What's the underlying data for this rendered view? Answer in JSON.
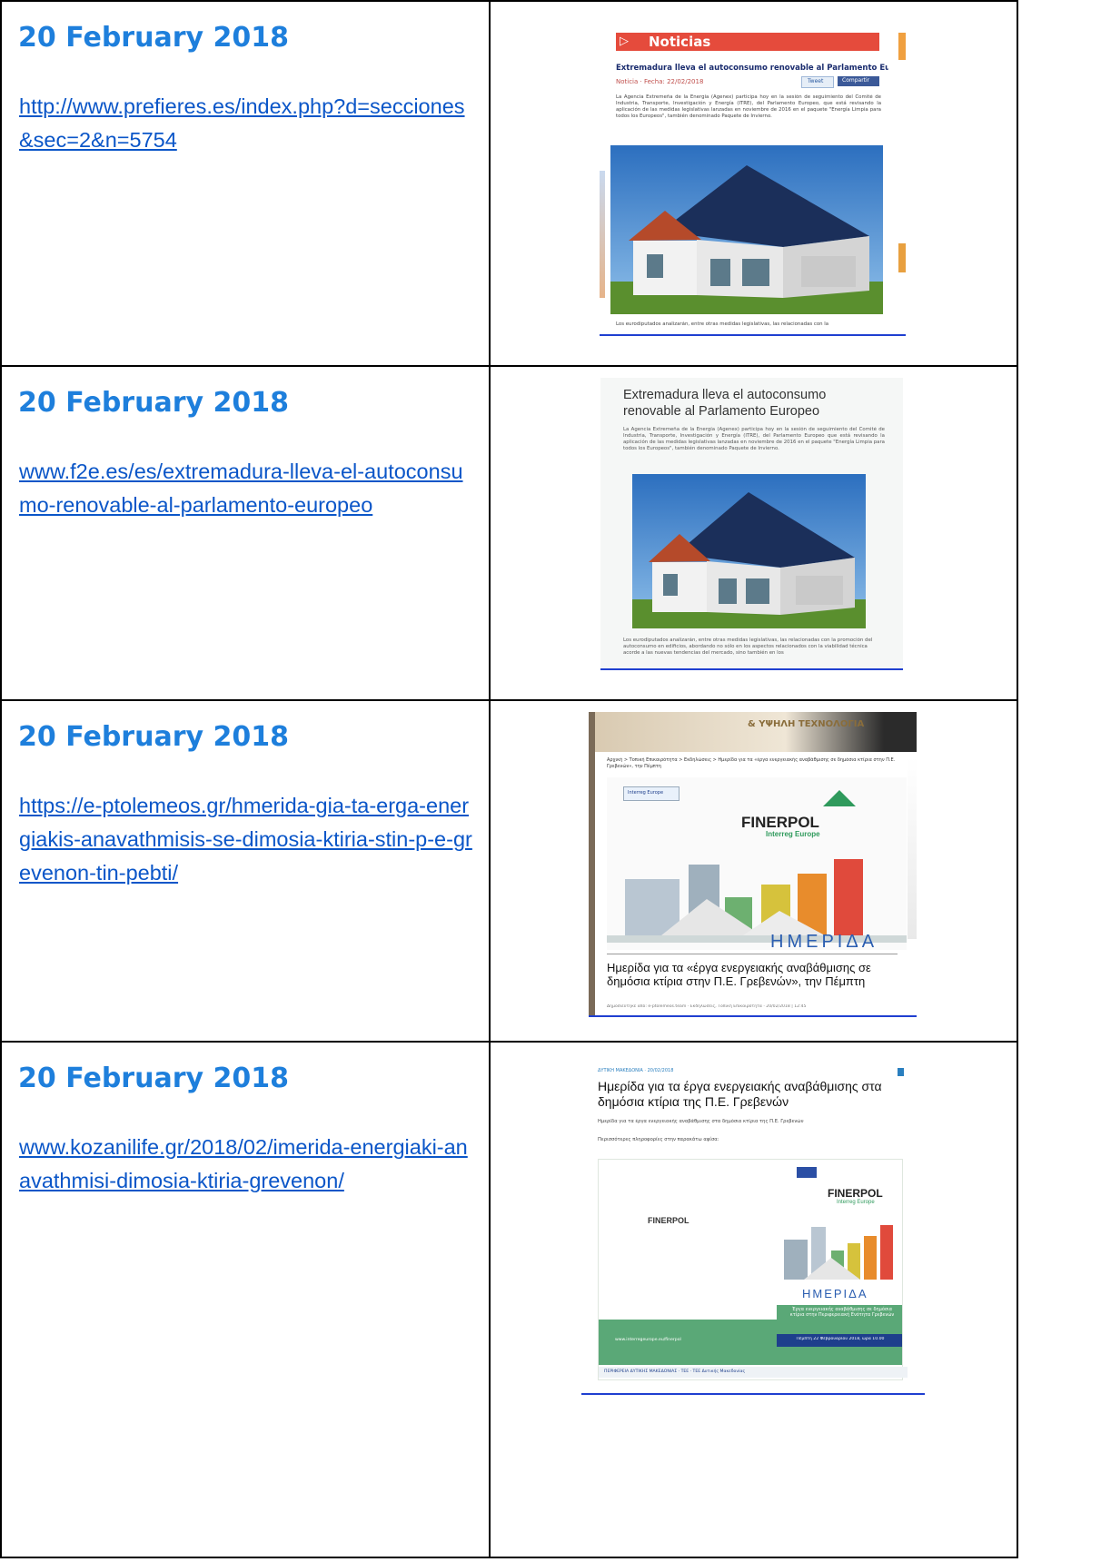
{
  "rows": [
    {
      "date": "20 February 2018",
      "url": "http://www.prefieres.es/index.php?d=secciones&sec=2&n=5754",
      "clip": {
        "section": "Noticias",
        "headline": "Extremadura lleva el autoconsumo renovable al Parlamento Europeo",
        "meta": "Noticia · Fecha: 22/02/2018",
        "tweet": "Tweet",
        "share": "Compartir",
        "lead": "La Agencia Extremeña de la Energía (Agenex) participa hoy en la sesión de seguimiento del Comité de Industria, Transporte, Investigación y Energía (ITRE), del Parlamento Europeo, que está revisando la aplicación de las medidas legislativas lanzadas en noviembre de 2016 en el paquete \"Energía Limpia para todos los Europeos\", también denominado Paquete de Invierno.",
        "tail": "Los eurodiputados analizarán, entre otras medidas legislativas, las relacionadas con la"
      }
    },
    {
      "date": "20 February 2018",
      "url": "www.f2e.es/es/extremadura-lleva-el-autoconsumo-renovable-al-parlamento-europeo",
      "clip": {
        "headline": "Extremadura lleva el autoconsumo renovable al Parlamento Europeo",
        "lead": "La Agencia Extremeña de la Energía (Agenex) participa hoy en la sesión de seguimiento del Comité de Industria, Transporte, Investigación y Energía (ITRE), del Parlamento Europeo que está revisando la aplicación de las medidas legislativas lanzadas en noviembre de 2016 en el paquete \"Energía Limpia para todos los Europeos\", también denominado Paquete de Invierno.",
        "tail": "Los eurodiputados analizarán, entre otras medidas legislativas, las relacionadas con la promoción del autoconsumo en edificios, abordando no sólo en los aspectos relacionados con la viabilidad técnica acorde a las nuevas tendencias del mercado, sino también en los"
      }
    },
    {
      "date": "20 February 2018",
      "url": "https://e-ptolemeos.gr/hmerida-gia-ta-erga-energiakis-anavathmisis-se-dimosia-ktiria-stin-p-e-grevenon-tin-pebti/",
      "clip": {
        "banner": "& ΥΨΗΛΗ ΤΕΧΝΟΛΟΓΙΑ",
        "breadcrumb": "Αρχική > Τοπική Επικαιρότητα > Εκδηλώσεις > Ημερίδα για τα «έργα ενεργειακής αναβάθμισης σε δημόσια κτίρια στην Π.Ε. Γρεβενών», την Πέμπτη",
        "logo": "FINERPOL",
        "logo_sub": "Interreg Europe",
        "eu": "Interreg Europe",
        "event": "ΗΜΕΡΙΔΑ",
        "headline": "Ημερίδα για τα «έργα ενεργειακής αναβάθμισης σε δημόσια κτίρια στην Π.Ε. Γρεβενών», την Πέμπτη",
        "byline": "Δημοσιεύτηκε από: e-ptolemeos.team · Εκδηλώσεις, Τοπική Επικαιρότητα · 20/02/2018 | 12:45"
      }
    },
    {
      "date": "20 February 2018",
      "url": "www.kozanilife.gr/2018/02/imerida-energiaki-anavathmisi-dimosia-ktiria-grevenon/",
      "clip": {
        "kicker": "ΔΥΤΙΚΗ ΜΑΚΕΔΟΝΙΑ · 20/02/2018",
        "headline": "Ημερίδα για τα έργα ενεργειακής αναβάθμισης στα δημόσια κτίρια της Π.Ε. Γρεβενών",
        "lead": "Ημερίδα για τα έργα ενεργειακής αναβάθμισης στα δημόσια κτίρια της Π.Ε. Γρεβενών",
        "more": "Περισσότερες πληροφορίες στην παρακάτω αφίσα:",
        "logo": "FINERPOL",
        "logo_sub": "Interreg Europe",
        "event": "ΗΜΕΡΙΔΑ",
        "poster_text": "Έργα ενεργειακής αναβάθμισης σε δημόσια κτίρια στην Περιφερειακή Ενότητα Γρεβενών",
        "poster_date": "Πέμπτη 22 Φεβρουαρίου 2018, ώρα 10.00",
        "website": "www.interregeurope.eu/finerpol",
        "footer": "ΠΕΡΙΦΕΡΕΙΑ ΔΥΤΙΚΗΣ ΜΑΚΕΔΟΝΙΑΣ · ΤΕΕ · ΤΕΕ Δυτικής Μακεδονίας"
      }
    }
  ],
  "colors": {
    "date": "#1e7fdc",
    "link": "#0b56c8",
    "noticias_red": "#e54b3c",
    "finerpol_green": "#2f9a5c",
    "poster_green": "#5aa877",
    "navy_bar": "#1e3f8c"
  }
}
